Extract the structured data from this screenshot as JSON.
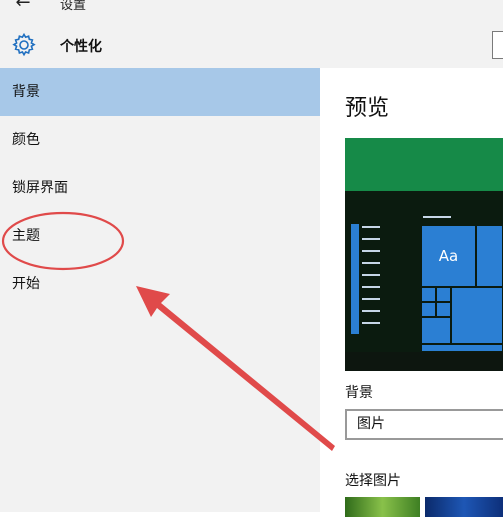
{
  "window": {
    "title": "设置",
    "back_icon": "back-arrow-icon",
    "back_glyph": "←"
  },
  "header": {
    "title": "个性化",
    "icon": "gear-icon"
  },
  "sidebar": {
    "items": [
      {
        "label": "背景",
        "selected": true
      },
      {
        "label": "颜色",
        "selected": false
      },
      {
        "label": "锁屏界面",
        "selected": false
      },
      {
        "label": "主题",
        "selected": false
      },
      {
        "label": "开始",
        "selected": false
      }
    ]
  },
  "main": {
    "preview_heading": "预览",
    "preview_tile_text": "Aa",
    "background_label": "背景",
    "background_value": "图片",
    "choose_picture_label": "选择图片"
  },
  "colors": {
    "selected_nav": "#a7c8e8",
    "sidebar_bg": "#f2f2f2",
    "preview_banner": "#168a48",
    "tile_blue": "#2b7fd3",
    "annotation_red": "#e04a4a"
  }
}
